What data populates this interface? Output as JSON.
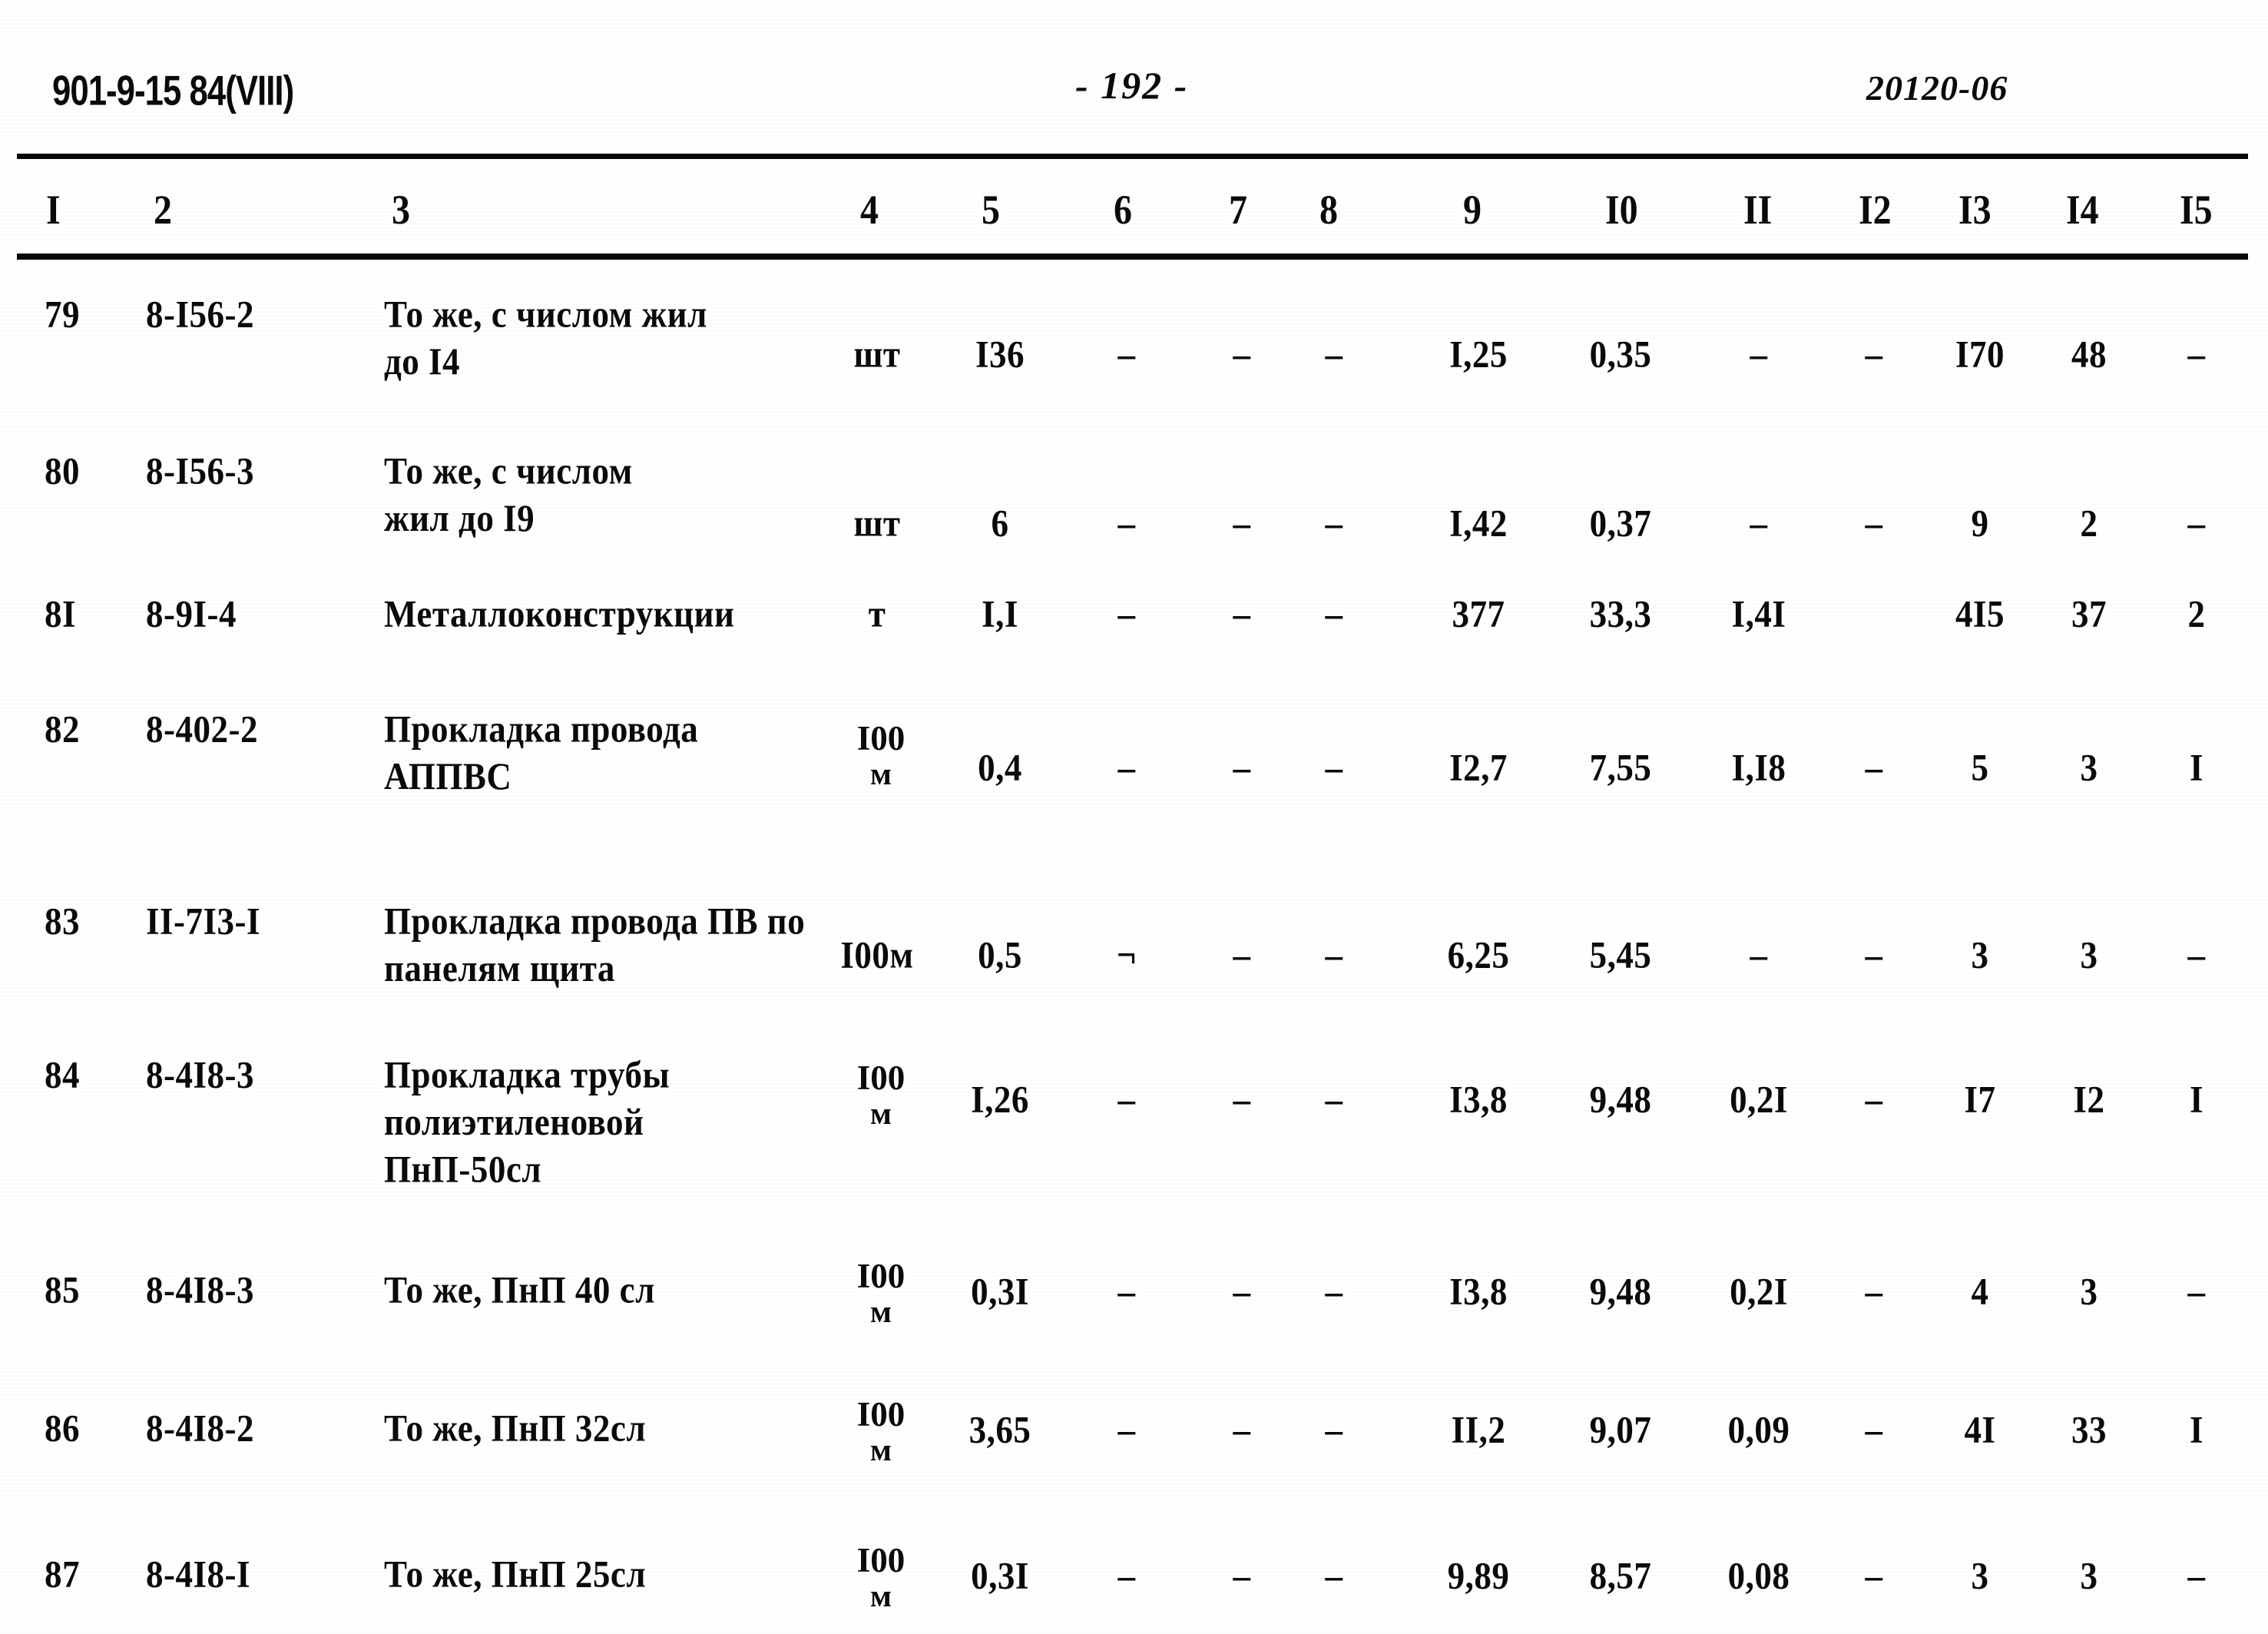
{
  "header": {
    "doc_code": "901-9-15 84(VIII)",
    "page_number": "- 192 -",
    "right_code": "20120-06"
  },
  "table": {
    "column_headers": [
      "I",
      "2",
      "3",
      "4",
      "5",
      "6",
      "7",
      "8",
      "9",
      "I0",
      "II",
      "I2",
      "I3",
      "I4",
      "I5"
    ],
    "rows": [
      {
        "no": "79",
        "code": "8-I56-2",
        "name": "То же, с числом жил\nдо I4",
        "unit": "шт",
        "unit_sub": "",
        "c5": "I36",
        "c6": "–",
        "c7": "–",
        "c8": "–",
        "c9": "I,25",
        "c10": "0,35",
        "c11": "–",
        "c12": "–",
        "c13": "I70",
        "c14": "48",
        "c15": "–"
      },
      {
        "no": "80",
        "code": "8-I56-3",
        "name": "То же, с  числом\nжил до I9",
        "unit": "шт",
        "unit_sub": "",
        "c5": "6",
        "c6": "–",
        "c7": "–",
        "c8": "–",
        "c9": "I,42",
        "c10": "0,37",
        "c11": "–",
        "c12": "–",
        "c13": "9",
        "c14": "2",
        "c15": "–"
      },
      {
        "no": "8I",
        "code": "8-9I-4",
        "name": "Металлоконструкции",
        "unit": "т",
        "unit_sub": "",
        "c5": "I,I",
        "c6": "–",
        "c7": "–",
        "c8": "–",
        "c9": "377",
        "c10": "33,3",
        "c11": "I,4I",
        "c12": "",
        "c13": "4I5",
        "c14": "37",
        "c15": "2"
      },
      {
        "no": "82",
        "code": "8-402-2",
        "name": "Прокладка провода\nАППВС",
        "unit": "I00",
        "unit_sub": "м",
        "c5": "0,4",
        "c6": "–",
        "c7": "–",
        "c8": "–",
        "c9": "I2,7",
        "c10": "7,55",
        "c11": "I,I8",
        "c12": "–",
        "c13": "5",
        "c14": "3",
        "c15": "I"
      },
      {
        "no": "83",
        "code": "II-7I3-I",
        "name": "Прокладка провода ПВ по\nпанелям щита",
        "unit": "I00м",
        "unit_sub": "",
        "c5": "0,5",
        "c6": "¬",
        "c7": "–",
        "c8": "–",
        "c9": "6,25",
        "c10": "5,45",
        "c11": "–",
        "c12": "–",
        "c13": "3",
        "c14": "3",
        "c15": "–"
      },
      {
        "no": "84",
        "code": "8-4I8-3",
        "name": "Прокладка трубы\nполиэтиленовой\nПнП-50сл",
        "unit": "I00",
        "unit_sub": "м",
        "c5": "I,26",
        "c6": "–",
        "c7": "–",
        "c8": "–",
        "c9": "I3,8",
        "c10": "9,48",
        "c11": "0,2I",
        "c12": "–",
        "c13": "I7",
        "c14": "I2",
        "c15": "I"
      },
      {
        "no": "85",
        "code": "8-4I8-3",
        "name": "То же, ПнП 40 сл",
        "unit": "I00",
        "unit_sub": "м",
        "c5": "0,3I",
        "c6": "–",
        "c7": "–",
        "c8": "–",
        "c9": "I3,8",
        "c10": "9,48",
        "c11": "0,2I",
        "c12": "–",
        "c13": "4",
        "c14": "3",
        "c15": "–"
      },
      {
        "no": "86",
        "code": "8-4I8-2",
        "name": "То же, ПнП 32сл",
        "unit": "I00",
        "unit_sub": "м",
        "c5": "3,65",
        "c6": "–",
        "c7": "–",
        "c8": "–",
        "c9": "II,2",
        "c10": "9,07",
        "c11": "0,09",
        "c12": "–",
        "c13": "4I",
        "c14": "33",
        "c15": "I"
      },
      {
        "no": "87",
        "code": "8-4I8-I",
        "name": "То же, ПнП 25сл",
        "unit": "I00",
        "unit_sub": "м",
        "c5": "0,3I",
        "c6": "–",
        "c7": "–",
        "c8": "–",
        "c9": "9,89",
        "c10": "8,57",
        "c11": "0,08",
        "c12": "–",
        "c13": "3",
        "c14": "3",
        "c15": "–"
      }
    ]
  },
  "layout": {
    "col_header_x": [
      60,
      200,
      510,
      1120,
      1278,
      1450,
      1600,
      1718,
      1905,
      2090,
      2270,
      2420,
      2550,
      2690,
      2838
    ],
    "row_tops": [
      378,
      582,
      768,
      918,
      1168,
      1368,
      1648,
      1828,
      2018
    ],
    "name_tops": [
      378,
      582,
      768,
      918,
      1168,
      1368,
      1648,
      1828,
      2018
    ],
    "value_tops": [
      430,
      650,
      768,
      968,
      1212,
      1400,
      1650,
      1830,
      2020
    ],
    "unit_tops": [
      430,
      650,
      768,
      938,
      1212,
      1380,
      1638,
      1818,
      2008
    ]
  }
}
